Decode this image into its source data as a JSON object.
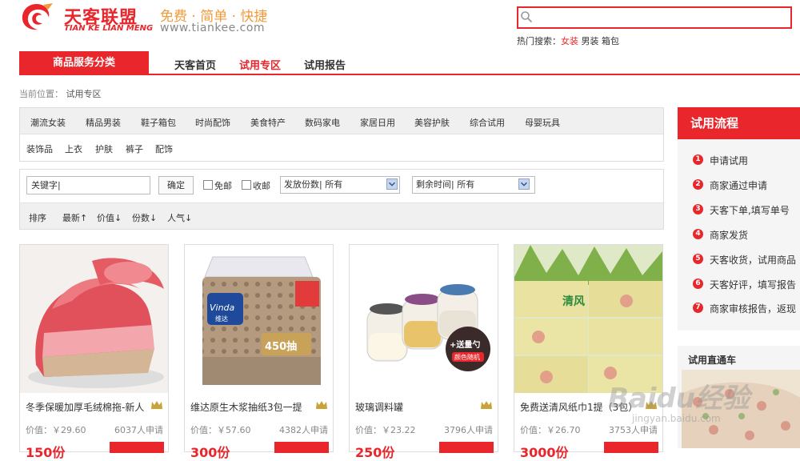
{
  "header": {
    "logo_cn": "天客联盟",
    "logo_en": "TIAN KE LIAN MENG",
    "slogan": "免费 · 简单 · 快捷",
    "url": "www.tiankee.com",
    "search_placeholder": "",
    "hot_search_label": "热门搜索：",
    "hot_terms": [
      "女装",
      "男装",
      "箱包"
    ]
  },
  "nav": {
    "category_label": "商品服务分类",
    "links": [
      "天客首页",
      "试用专区",
      "试用报告"
    ],
    "active": "试用专区"
  },
  "breadcrumb": {
    "label": "当前位置：",
    "current": "试用专区"
  },
  "categories": {
    "row1": [
      "潮流女装",
      "精品男装",
      "鞋子箱包",
      "时尚配饰",
      "美食特产",
      "数码家电",
      "家居日用",
      "美容护肤",
      "综合试用",
      "母婴玩具"
    ],
    "row2": [
      "装饰品",
      "上衣",
      "护肤",
      "裤子",
      "配饰"
    ]
  },
  "filter": {
    "keyword_value": "关键字|",
    "ok_label": "确定",
    "checkbox_free": "免邮",
    "checkbox_collect": "收邮",
    "select_count_label": "发放份数",
    "select_count_value": "所有",
    "select_time_label": "剩余时间",
    "select_time_value": "所有",
    "sort_label": "排序",
    "sort_items": [
      "最新",
      "价值",
      "份数",
      "人气"
    ],
    "sort_arrows": [
      "↑",
      "↓",
      "↓",
      "↓"
    ]
  },
  "products": [
    {
      "title": "冬季保暖加厚毛绒棉拖-新人",
      "price": "价值：￥29.60",
      "applicants": "6037人申请",
      "count": "150份"
    },
    {
      "title": "维达原生木浆抽纸3包一提",
      "price": "价值：￥57.60",
      "applicants": "4382人申请",
      "count": "300份"
    },
    {
      "title": "玻璃调料罐",
      "price": "价值：￥23.22",
      "applicants": "3796人申请",
      "count": "250份"
    },
    {
      "title": "免费送清风纸巾1提（3包）",
      "price": "价值：￥26.70",
      "applicants": "3753人申请",
      "count": "3000份"
    }
  ],
  "product_badges": {
    "vinda_brand": "Vinda",
    "vinda_sub": "维达",
    "vinda_draw": "450抽",
    "spoon_badge_1": "+送量勺",
    "spoon_badge_2": "颜色随机",
    "qingfeng_brand": "清风"
  },
  "sidebar": {
    "flow_title": "试用流程",
    "steps": [
      "申请试用",
      "商家通过申请",
      "天客下单,填写单号",
      "商家发货",
      "天客收货，试用商品",
      "天客好评，填写报告",
      "商家审核报告，返现"
    ],
    "direct_title": "试用直通车"
  },
  "watermark": {
    "main": "Baidu经验",
    "sub": "jingyan.baidu.com"
  },
  "colors": {
    "brand_red": "#e8262b",
    "slogan_orange": "#f29a38"
  }
}
